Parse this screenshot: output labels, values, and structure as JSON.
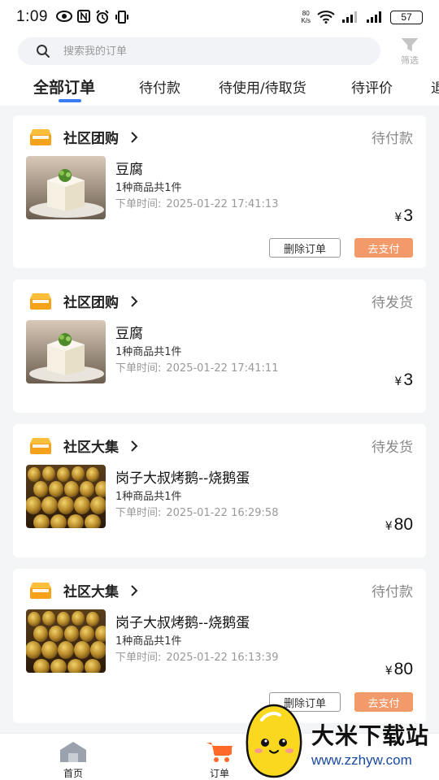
{
  "status_bar": {
    "time": "1:09",
    "net_speed_top": "80",
    "net_speed_unit": "K/s",
    "battery": "57"
  },
  "search": {
    "placeholder": "搜索我的订单",
    "filter_label": "筛选"
  },
  "tabs": [
    {
      "label": "全部订单",
      "active": true
    },
    {
      "label": "待付款"
    },
    {
      "label": "待使用/待取货"
    },
    {
      "label": "待评价"
    },
    {
      "label": "退"
    }
  ],
  "orders": [
    {
      "shop": "社区团购",
      "status": "待付款",
      "product": "豆腐",
      "count": "1种商品共1件",
      "time_label": "下单时间:",
      "time": "2025-01-22 17:41:13",
      "currency": "¥",
      "price": "3",
      "delete_label": "删除订单",
      "pay_label": "去支付"
    },
    {
      "shop": "社区团购",
      "status": "待发货",
      "product": "豆腐",
      "count": "1种商品共1件",
      "time_label": "下单时间:",
      "time": "2025-01-22 17:41:11",
      "currency": "¥",
      "price": "3"
    },
    {
      "shop": "社区大集",
      "status": "待发货",
      "product": "岗子大叔烤鹅--烧鹅蛋",
      "count": "1种商品共1件",
      "time_label": "下单时间:",
      "time": "2025-01-22 16:29:58",
      "currency": "¥",
      "price": "80"
    },
    {
      "shop": "社区大集",
      "status": "待付款",
      "product": "岗子大叔烤鹅--烧鹅蛋",
      "count": "1种商品共1件",
      "time_label": "下单时间:",
      "time": "2025-01-22 16:13:39",
      "currency": "¥",
      "price": "80",
      "delete_label": "删除订单",
      "pay_label": "去支付"
    }
  ],
  "bottom_nav": [
    {
      "label": "首页"
    },
    {
      "label": "订单"
    }
  ],
  "watermark": {
    "title": "大米下载站",
    "url": "www.zzhyw.com"
  },
  "colors": {
    "accent": "#3b7df2",
    "pay": "#f39a6b",
    "shop_icon": "#f7a21b"
  }
}
